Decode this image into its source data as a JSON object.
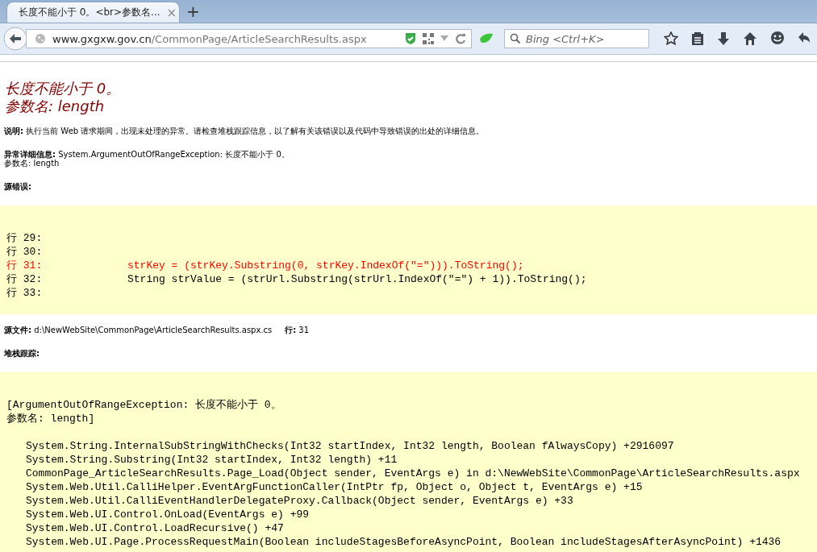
{
  "browser": {
    "tab": {
      "title": "长度不能小于 0。<br>参数名...",
      "selected": true,
      "close": "×"
    },
    "new_tab": "+",
    "url": {
      "host": "www.gxgxw.gov.cn",
      "path": "/CommonPage/ArticleSearchResults.aspx"
    },
    "search": {
      "placeholder": "Bing <Ctrl+K>"
    }
  },
  "error": {
    "title_lines": [
      "长度不能小于 0。",
      "参数名: length"
    ],
    "description": {
      "label": "说明:",
      "text": "执行当前 Web 请求期间，出现未处理的异常。请检查堆栈跟踪信息，以了解有关该错误以及代码中导致错误的出处的详细信息。"
    },
    "details": {
      "label": "异常详细信息:",
      "text": "System.ArgumentOutOfRangeException: 长度不能小于 0。",
      "text_2": "参数名: length"
    },
    "source_error": {
      "label": "源错误:",
      "lines": [
        {
          "number": "行 29:",
          "highlighted": false
        },
        {
          "number": "行 30:",
          "highlighted": false
        },
        {
          "number": "行 31:",
          "code": "strKey = (strKey.Substring(0, strKey.IndexOf(\"=\"))).ToString();",
          "highlighted": true
        },
        {
          "number": "行 32:",
          "code": "String strValue = (strUrl.Substring(strUrl.IndexOf(\"=\") + 1)).ToString();",
          "highlighted": false
        },
        {
          "number": "行 33:",
          "highlighted": false
        }
      ]
    },
    "source_file": {
      "label": "源文件:",
      "path": "d:\\NewWebSite\\CommonPage\\ArticleSearchResults.aspx.cs",
      "line_label": "行:",
      "line": "31"
    },
    "stack_trace": {
      "label": "堆栈跟踪:",
      "header": [
        "[ArgumentOutOfRangeException: 长度不能小于 0。",
        "参数名: length]"
      ],
      "frames": [
        "System.String.InternalSubStringWithChecks(Int32 startIndex, Int32 length, Boolean fAlwaysCopy) +2916097",
        "System.String.Substring(Int32 startIndex, Int32 length) +11",
        "CommonPage_ArticleSearchResults.Page_Load(Object sender, EventArgs e) in d:\\NewWebSite\\CommonPage\\ArticleSearchResults.aspx",
        "System.Web.Util.CalliHelper.EventArgFunctionCaller(IntPtr fp, Object o, Object t, EventArgs e) +15",
        "System.Web.Util.CalliEventHandlerDelegateProxy.Callback(Object sender, EventArgs e) +33",
        "System.Web.UI.Control.OnLoad(EventArgs e) +99",
        "System.Web.UI.Control.LoadRecursive() +47",
        "System.Web.UI.Page.ProcessRequestMain(Boolean includeStagesBeforeAsyncPoint, Boolean includeStagesAfterAsyncPoint) +1436"
      ]
    }
  }
}
